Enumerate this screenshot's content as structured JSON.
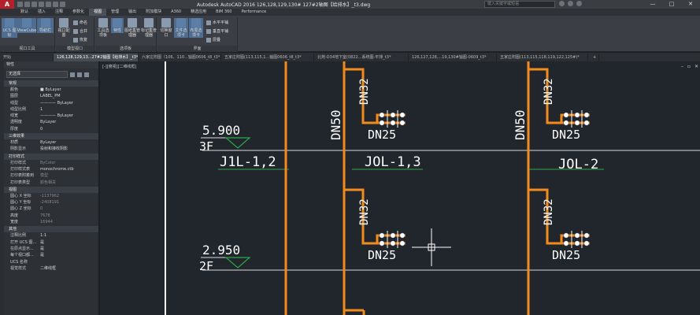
{
  "app": {
    "title": "Autodesk AutoCAD 2016    126,128,129,130# 127#2轴图【给排水】_t3.dwg",
    "logo": "A",
    "search_placeholder": "键入关键字或短语"
  },
  "menu": [
    "默认",
    "插入",
    "注释",
    "参数化",
    "视图",
    "管理",
    "输出",
    "附加模块",
    "A360",
    "精选应用",
    "BIM 360",
    "Performance"
  ],
  "ribbon": {
    "viewport_tools": {
      "label": "视口工具",
      "buttons": [
        "UCS 图标",
        "ViewCube",
        "导航栏"
      ]
    },
    "model_viewports": {
      "label": "模型视口",
      "big": "视口配置",
      "small": [
        "命名",
        "合并",
        "恢复"
      ]
    },
    "palettes": {
      "label": "选项板",
      "buttons": [
        "工具选项板",
        "特性",
        "图纸集管理器",
        "标记集管理器"
      ]
    },
    "interface": {
      "label": "界面",
      "buttons": [
        "切换窗口",
        "文件选项卡",
        "布局选项卡"
      ],
      "small": [
        "水平平铺",
        "垂直平铺",
        "层叠"
      ]
    }
  },
  "tabs": [
    "开始",
    "126,128,129,13...27#2轴图【给排水】_t3*",
    "六家庄附图（106、110...轴图0606_t8_t3*",
    "五家庄附图(113,115,1...轴图0606_t8_t3*",
    "北苑-D34地下室(0822...系统图-平排_t3*",
    "126,127,128,...19,130#轴图-0609_t3*",
    "五家庄附图(113,115,118,119,122,125#)*",
    "+"
  ],
  "properties": {
    "header": "特性",
    "selection": "无选择",
    "sections": [
      {
        "title": "常规",
        "rows": [
          [
            "颜色",
            "■ ByLayer",
            false
          ],
          [
            "图层",
            "LABEL_PM",
            false
          ],
          [
            "线型",
            "———— ByLayer",
            false
          ],
          [
            "线型比例",
            "1",
            false
          ],
          [
            "线宽",
            "———— ByLayer",
            false
          ],
          [
            "透明度",
            "ByLayer",
            false
          ],
          [
            "厚度",
            "0",
            false
          ]
        ]
      },
      {
        "title": "三维效果",
        "rows": [
          [
            "材质",
            "ByLayer",
            false
          ],
          [
            "阴影显示",
            "投射和接收阴影",
            false
          ]
        ]
      },
      {
        "title": "打印样式",
        "rows": [
          [
            "打印样式",
            "ByColor",
            true
          ],
          [
            "打印样式表",
            "monochrome.ctb",
            false
          ],
          [
            "打印表附着到",
            "模型",
            true
          ],
          [
            "打印表类型",
            "颜色相关",
            true
          ]
        ]
      },
      {
        "title": "视图",
        "rows": [
          [
            "圆心 X 坐标",
            "-1137962",
            true
          ],
          [
            "圆心 Y 坐标",
            "-2408191",
            true
          ],
          [
            "圆心 Z 坐标",
            "0",
            true
          ],
          [
            "高度",
            "7678",
            true
          ],
          [
            "宽度",
            "16944",
            true
          ]
        ]
      },
      {
        "title": "其他",
        "rows": [
          [
            "注释比例",
            "1:1",
            false
          ],
          [
            "打开 UCS 图...",
            "是",
            false
          ],
          [
            "在原点显示...",
            "是",
            false
          ],
          [
            "每个视口都...",
            "是",
            false
          ],
          [
            "UCS 名称",
            "",
            false
          ],
          [
            "视觉样式",
            "二维线框",
            false
          ]
        ]
      }
    ]
  },
  "viewport": {
    "label": "[-][俯视][二维线框]"
  },
  "drawing": {
    "levels": [
      {
        "elev": "5.900",
        "floor": "3F"
      },
      {
        "elev": "2.950",
        "floor": "2F"
      }
    ],
    "pipe_labels": [
      "J1L-1,2",
      "JOL-1,3",
      "JOL-2"
    ],
    "dn_main": "DN50",
    "dn_branch": "DN32",
    "dn_small": "DN25"
  },
  "colors": {
    "pipe": "#f28a1c",
    "canvas": "#21252c",
    "level_green": "#2ea84a",
    "text": "#ffffff"
  }
}
